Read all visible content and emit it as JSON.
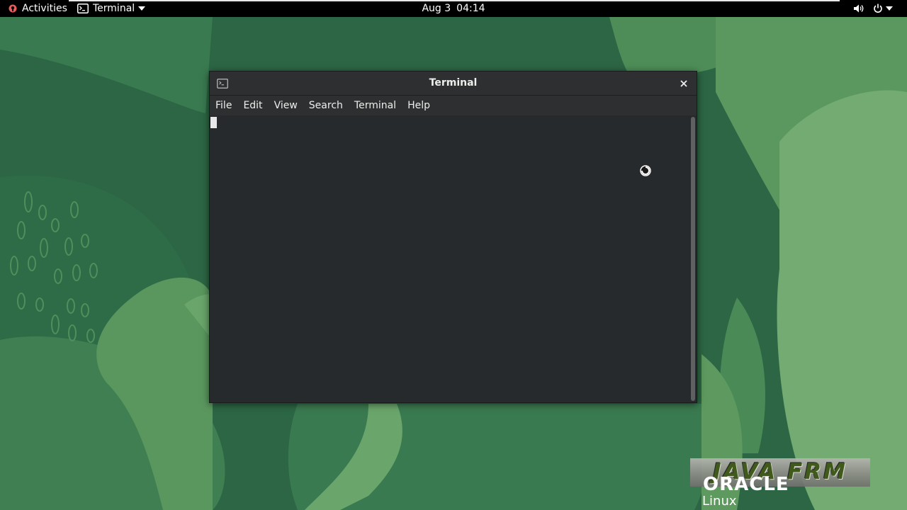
{
  "topbar": {
    "activities_label": "Activities",
    "app_name": "Terminal",
    "clock_date": "Aug 3",
    "clock_time": "04:14"
  },
  "terminal_window": {
    "title": "Terminal",
    "menu": [
      "File",
      "Edit",
      "View",
      "Search",
      "Terminal",
      "Help"
    ]
  },
  "watermark": {
    "brand": "JAVA FRM",
    "vendor": "ORACLE",
    "product": "Linux"
  },
  "colors": {
    "wallpaper_dark": "#2c6644",
    "wallpaper_light": "#5e9a5f",
    "terminal_bg": "#272a2c",
    "topbar_bg": "#000000"
  },
  "icons": [
    "activities-icon",
    "terminal-app-icon",
    "chevron-down-icon",
    "volume-icon",
    "power-icon",
    "terminal-title-icon",
    "close-icon",
    "busy-pointer-icon"
  ]
}
